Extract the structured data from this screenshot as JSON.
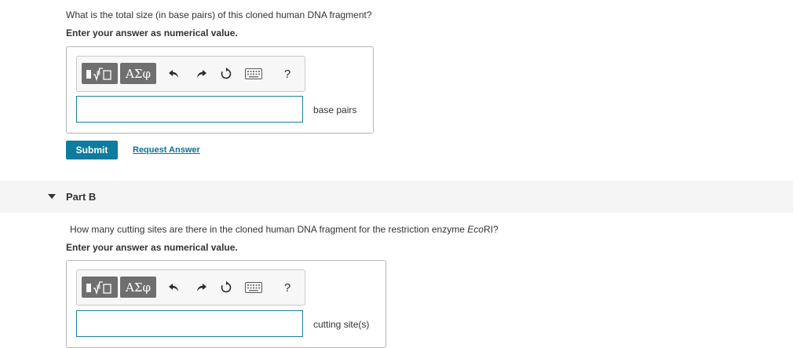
{
  "part_a": {
    "question": "What is the total size (in base pairs) of this cloned human DNA fragment?",
    "instruction": "Enter your answer as numerical value.",
    "toolbar": {
      "symbols_label": "ΑΣφ",
      "help_label": "?"
    },
    "input_value": "",
    "unit": "base pairs",
    "submit_label": "Submit",
    "request_answer_label": "Request Answer"
  },
  "part_b": {
    "title": "Part B",
    "question_prefix": "How many cutting sites are there in the cloned human DNA fragment for the restriction enzyme ",
    "question_enzyme": "Eco",
    "question_suffix": "RI?",
    "instruction": "Enter your answer as numerical value.",
    "toolbar": {
      "symbols_label": "ΑΣφ",
      "help_label": "?"
    },
    "input_value": "",
    "unit": "cutting site(s)"
  },
  "icons": [
    "templates-icon",
    "undo-icon",
    "redo-icon",
    "reset-icon",
    "keyboard-icon",
    "help-icon",
    "caret-down-icon"
  ],
  "colors": {
    "accent": "#0e7c9e",
    "link": "#0e6f99",
    "toolbar_button": "#6f6f6f",
    "input_border": "#1b7f9a",
    "part_header_bg": "#f5f5f5"
  }
}
